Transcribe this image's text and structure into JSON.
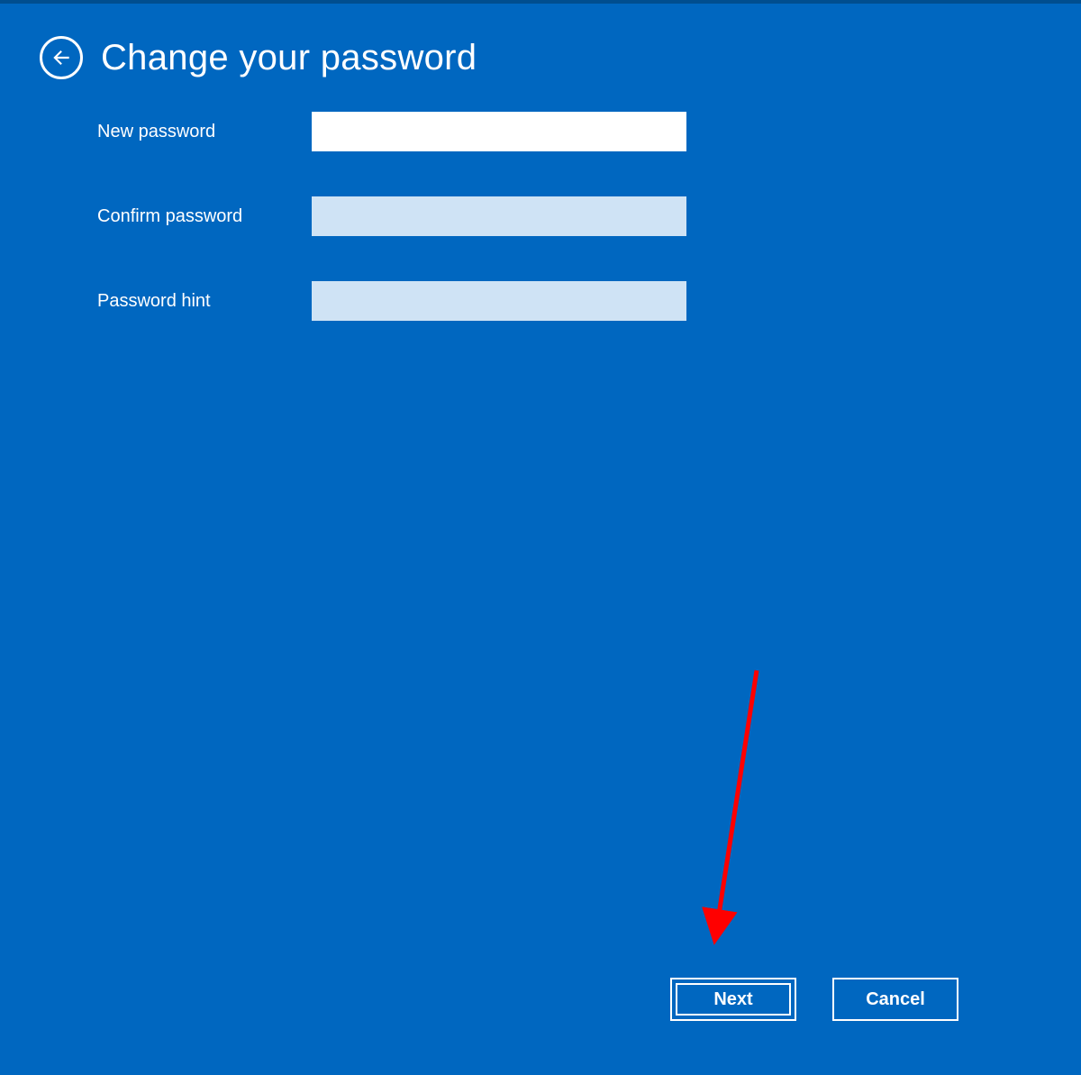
{
  "header": {
    "title": "Change your password"
  },
  "form": {
    "new_password_label": "New password",
    "new_password_value": "",
    "confirm_password_label": "Confirm password",
    "confirm_password_value": "",
    "password_hint_label": "Password hint",
    "password_hint_value": ""
  },
  "footer": {
    "next_label": "Next",
    "cancel_label": "Cancel"
  },
  "annotation": {
    "arrow_color": "#ff0000"
  }
}
